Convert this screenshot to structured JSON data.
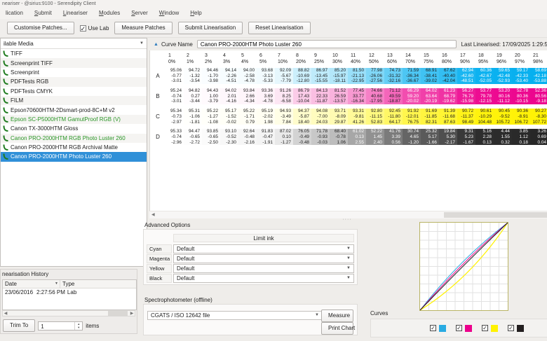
{
  "window": {
    "title": "neariser - @sirius:9100 - Serendipity Client"
  },
  "menu": {
    "items": [
      {
        "label": "lication",
        "u": -1
      },
      {
        "label": "Submit",
        "u": 0
      },
      {
        "label": "Lineariser",
        "u": 0
      },
      {
        "label": "Modules",
        "u": 0
      },
      {
        "label": "Server",
        "u": 0
      },
      {
        "label": "Window",
        "u": 0
      },
      {
        "label": "Help",
        "u": 0
      }
    ]
  },
  "toolbar": {
    "customise": "Customise Patches...",
    "use_lab": "Use Lab",
    "use_lab_checked": "✓",
    "measure": "Measure Patches",
    "submit": "Submit Linearisation",
    "reset": "Reset Linearisation"
  },
  "media_panel": {
    "header": "ilable Media",
    "items": [
      {
        "label": "TIFF",
        "green": false,
        "selected": false
      },
      {
        "label": "Screenprint TIFF",
        "green": false,
        "selected": false
      },
      {
        "label": "Screenprint",
        "green": false,
        "selected": false
      },
      {
        "label": "PDFTests RGB",
        "green": false,
        "selected": false
      },
      {
        "label": "PDFTests CMYK",
        "green": false,
        "selected": false
      },
      {
        "label": "FILM",
        "green": false,
        "selected": false
      },
      {
        "label": "Epson70600HTM-2Dsmart-prod-8C+M v2",
        "green": false,
        "selected": false
      },
      {
        "label": "Epson SC-P5000HTM GamutProof RGB (V)",
        "green": true,
        "selected": false
      },
      {
        "label": "Canon TX-3000HTM Gloss",
        "green": false,
        "selected": false
      },
      {
        "label": "Canon PRO-2000HTM RGB Photo Luster 260",
        "green": true,
        "selected": false
      },
      {
        "label": "Canon PRO-2000HTM RGB Archival Matte",
        "green": false,
        "selected": false
      },
      {
        "label": "Canon PRO-2000HTM Photo Luster 260",
        "green": false,
        "selected": true
      }
    ]
  },
  "history_panel": {
    "title": "nearisation History",
    "col_date": "Date",
    "col_type": "Type",
    "rows": [
      {
        "date": "23/06/2016",
        "time": "2:27:56 PM",
        "type": "Lab"
      }
    ],
    "trim_label": "Trim To",
    "trim_value": "1",
    "items_label": "items"
  },
  "curve_bar": {
    "label": "Curve Name",
    "value": "Canon PRO-2000HTM Photo Luster 260",
    "last_linearised": "Last Linearised:  17/09/2025 1:29:5"
  },
  "table": {
    "col_numbers": [
      "1",
      "2",
      "3",
      "4",
      "5",
      "6",
      "7",
      "8",
      "9",
      "10",
      "11",
      "12",
      "13",
      "14",
      "15",
      "16",
      "17",
      "18",
      "19",
      "20",
      "21"
    ],
    "col_percents": [
      "0%",
      "1%",
      "2%",
      "3%",
      "4%",
      "5%",
      "10%",
      "20%",
      "25%",
      "30%",
      "40%",
      "50%",
      "60%",
      "70%",
      "75%",
      "80%",
      "90%",
      "95%",
      "96%",
      "97%",
      "98%"
    ],
    "intensities": [
      0,
      0.01,
      0.02,
      0.03,
      0.04,
      0.05,
      0.1,
      0.2,
      0.25,
      0.3,
      0.4,
      0.5,
      0.6,
      0.7,
      0.75,
      0.8,
      0.9,
      0.95,
      0.96,
      0.97,
      0.98
    ],
    "rows": [
      {
        "label": "A",
        "channel": "cyan",
        "lines": [
          [
            "95.06",
            "94.72",
            "94.46",
            "94.14",
            "94.00",
            "93.68",
            "92.09",
            "88.82",
            "86.97",
            "85.20",
            "81.50",
            "77.98",
            "74.73",
            "71.59",
            "68.91",
            "67.62",
            "62.94",
            "60.36",
            "59.65",
            "59.17",
            "58.69"
          ],
          [
            "-0.77",
            "-1.32",
            "-1.70",
            "-2.26",
            "-2.58",
            "-3.13",
            "-5.67",
            "-10.69",
            "-13.45",
            "-15.97",
            "-21.13",
            "-26.06",
            "-31.32",
            "-36.34",
            "-38.41",
            "-40.40",
            "-42.60",
            "-42.67",
            "-42.48",
            "-42.33",
            "-42.18"
          ],
          [
            "-3.01",
            "-3.54",
            "-3.98",
            "-4.51",
            "-4.78",
            "-5.33",
            "-7.79",
            "-12.80",
            "-15.55",
            "-18.11",
            "-22.95",
            "-27.56",
            "-32.16",
            "-36.67",
            "-39.02",
            "-42.04",
            "-48.51",
            "-52.05",
            "-52.93",
            "-53.40",
            "-53.88"
          ]
        ]
      },
      {
        "label": "B",
        "channel": "magenta",
        "lines": [
          [
            "95.24",
            "94.82",
            "94.43",
            "94.02",
            "93.84",
            "93.36",
            "91.26",
            "86.79",
            "84.13",
            "81.52",
            "77.45",
            "74.66",
            "71.12",
            "66.29",
            "64.02",
            "61.23",
            "56.27",
            "53.77",
            "53.20",
            "52.78",
            "52.36"
          ],
          [
            "-0.74",
            "0.27",
            "1.00",
            "2.01",
            "2.66",
            "3.69",
            "8.25",
            "17.43",
            "22.33",
            "26.59",
            "33.77",
            "40.68",
            "49.59",
            "59.20",
            "63.64",
            "68.79",
            "76.79",
            "79.78",
            "80.16",
            "80.36",
            "80.56"
          ],
          [
            "-3.01",
            "-3.44",
            "-3.79",
            "-4.16",
            "-4.34",
            "-4.78",
            "-6.58",
            "-10.04",
            "-11.87",
            "-13.57",
            "-16.34",
            "-17.95",
            "-18.87",
            "-20.02",
            "-20.19",
            "-19.62",
            "-15.98",
            "-12.15",
            "-11.12",
            "-10.15",
            "-9.18"
          ]
        ]
      },
      {
        "label": "C",
        "channel": "yellow",
        "lines": [
          [
            "95.34",
            "95.31",
            "95.22",
            "95.17",
            "95.22",
            "95.19",
            "94.93",
            "94.37",
            "94.08",
            "93.71",
            "93.31",
            "92.80",
            "92.45",
            "91.92",
            "91.69",
            "91.39",
            "90.72",
            "90.61",
            "90.45",
            "90.36",
            "90.27"
          ],
          [
            "-0.73",
            "-1.06",
            "-1.27",
            "-1.52",
            "-1.71",
            "-2.02",
            "-3.49",
            "-5.87",
            "-7.00",
            "-8.09",
            "-9.81",
            "-11.15",
            "-11.80",
            "-12.01",
            "-11.85",
            "-11.68",
            "-11.37",
            "-10.29",
            "-9.52",
            "-8.91",
            "-8.30"
          ],
          [
            "-2.97",
            "-1.81",
            "-1.08",
            "-0.02",
            "0.79",
            "1.98",
            "7.84",
            "18.40",
            "24.03",
            "29.87",
            "41.26",
            "52.83",
            "64.17",
            "76.75",
            "82.31",
            "87.63",
            "98.49",
            "104.48",
            "105.72",
            "106.72",
            "107.72"
          ]
        ]
      },
      {
        "label": "D",
        "channel": "black",
        "lines": [
          [
            "95.33",
            "94.47",
            "93.85",
            "93.10",
            "92.64",
            "91.83",
            "87.02",
            "76.05",
            "71.78",
            "68.40",
            "61.02",
            "52.22",
            "41.76",
            "30.74",
            "25.32",
            "19.84",
            "9.31",
            "5.16",
            "4.44",
            "3.85",
            "3.26"
          ],
          [
            "-0.74",
            "-0.65",
            "-0.65",
            "-0.52",
            "-0.48",
            "-0.47",
            "0.10",
            "-0.49",
            "-0.93",
            "-0.78",
            "0.13",
            "1.45",
            "3.39",
            "4.65",
            "5.17",
            "5.30",
            "5.23",
            "2.28",
            "1.55",
            "1.12",
            "0.69"
          ],
          [
            "-2.96",
            "-2.72",
            "-2.50",
            "-2.30",
            "-2.16",
            "-1.91",
            "-1.27",
            "-0.48",
            "-0.03",
            "1.06",
            "2.55",
            "2.40",
            "0.56",
            "-1.20",
            "-1.66",
            "-2.17",
            "-1.67",
            "0.13",
            "0.32",
            "0.18",
            "0.04"
          ]
        ]
      }
    ]
  },
  "advanced": {
    "title": "Advanced Options",
    "header": "Limit ink",
    "rows": [
      {
        "label": "Cyan",
        "value": "Default"
      },
      {
        "label": "Magenta",
        "value": "Default"
      },
      {
        "label": "Yellow",
        "value": "Default"
      },
      {
        "label": "Black",
        "value": "Default"
      }
    ]
  },
  "spectro": {
    "title": "Spectrophotometer (offline)",
    "file": "CGATS / ISO 12642 file",
    "measure": "Measure",
    "print": "Print Chart"
  },
  "curves_panel": {
    "label": "Curves",
    "channels": [
      {
        "name": "cyan",
        "color": "#29abe2",
        "checked": true
      },
      {
        "name": "magenta",
        "color": "#ec008c",
        "checked": true
      },
      {
        "name": "yellow",
        "color": "#fff200",
        "checked": true
      },
      {
        "name": "black",
        "color": "#231f20",
        "checked": true
      }
    ]
  },
  "colors": {
    "cyan": "#00aeef",
    "magenta": "#ec008c",
    "yellow": "#fff200",
    "black": "#232323",
    "selection": "#3090d8",
    "green_item": "#2a9627",
    "chart_border": "#b9b465"
  }
}
